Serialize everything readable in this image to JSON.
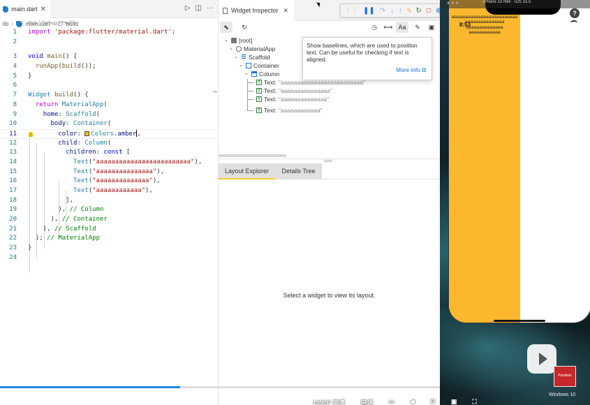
{
  "editor": {
    "tab_label": "main.dart",
    "tab_close": "✕",
    "breadcrumb": [
      "lib",
      "main.dart",
      "build"
    ],
    "codelens": "Run | Debug | Profile",
    "line_numbers": [
      "1",
      "2",
      "3",
      "4",
      "5",
      "6",
      "7",
      "8",
      "9",
      "10",
      "11",
      "12",
      "13",
      "14",
      "15",
      "16",
      "17",
      "18",
      "19",
      "20",
      "21",
      "22",
      "23",
      "24"
    ],
    "code": {
      "l1_kw": "import",
      "l1_str": "'package:flutter/material.dart'",
      "l3_type": "void",
      "l3_fn": "main",
      "l4_fn": "runApp",
      "l4_call": "build",
      "l7_type": "Widget",
      "l7_fn": "build",
      "l8_kw": "return",
      "l8_cls": "MaterialApp",
      "l9_prm": "home",
      "l9_cls": "Scaffold",
      "l10_prm": "body",
      "l10_cls": "Container",
      "l11_prm": "color",
      "l11_cls": "Colors",
      "l11_val": "amber",
      "l12_prm": "child",
      "l12_cls": "Column",
      "l13_prm": "children",
      "l13_kw": "const",
      "l14_str": "\"aaaaaaaaaaaaaaaaaaaaaaaaa\"",
      "l15_str": "\"aaaaaaaaaaaaaaa\"",
      "l16_str": "\"aaaaaaaaaaaaaa\"",
      "l17_str": "\"aaaaaaaaaaaa\"",
      "text_cls": "Text",
      "l19_cmt": "// Column",
      "l20_cmt": "// Container",
      "l21_cmt": "// Scaffold",
      "l22_cmt": "// MaterialApp"
    }
  },
  "inspector": {
    "tab_label": "Widget Inspector",
    "tooltip_text": "Show baselines, which are used to position text. Can be useful for checking if text is aligned.",
    "tooltip_link": "More info",
    "tree": {
      "root": "[root]",
      "material_app": "MaterialApp",
      "scaffold": "Scaffold",
      "container": "Container",
      "column": "Column",
      "text_prefix": "Text:",
      "texts": [
        "\"aaaaaaaaaaaaaaaaaaaaaaaaa\"",
        "\"aaaaaaaaaaaaaaa\"",
        "\"aaaaaaaaaaaaaa\"",
        "\"aaaaaaaaaaaa\""
      ]
    },
    "subtabs": [
      "Layout Explorer",
      "Details Tree"
    ],
    "placeholder": "Select a widget to view its layout."
  },
  "simulator": {
    "header": "iPhone 13 mini · iOS 15.5",
    "time": "8:53",
    "lines": [
      "aaaaaaaaaaaaaaaaaaaaaaaaa",
      "aaaaaaaaaaaaaaa",
      "aaaaaaaaaaaaaa",
      "aaaaaaaaaaaa"
    ],
    "help": "?",
    "parallels": "Parallels",
    "windows_label": "Windows 10",
    "colors": {
      "amber": "#fbb72d"
    }
  },
  "player": {
    "progress_fraction": 0.41,
    "labels": [
      "1080P 高清",
      "倍速"
    ]
  }
}
